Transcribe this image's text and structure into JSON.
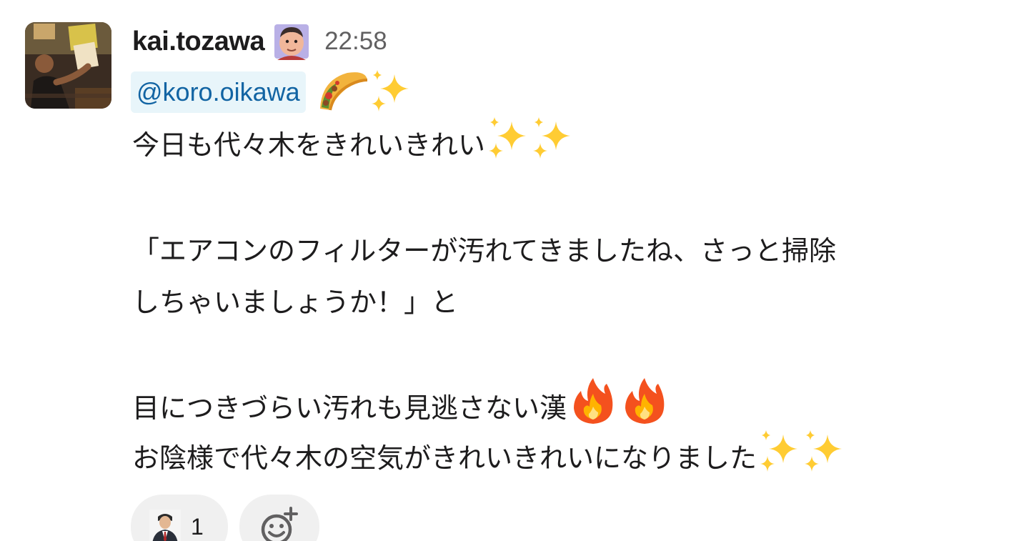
{
  "message": {
    "username": "kai.tozawa",
    "timestamp": "22:58",
    "mention": "@koro.oikawa",
    "lines": [
      "今日も代々木をきれいきれい",
      "",
      "「エアコンのフィルターが汚れてきましたね、さっと掃除",
      "しちゃいましょうか！」と",
      "",
      "目につきづらい汚れも見逃さない漢",
      "お陰様で代々木の空気がきれいきれいになりました"
    ],
    "icons": {
      "avatar": "user-photo-avatar",
      "status": "face-emoji",
      "mention_trailing": [
        "taco-emoji",
        "sparkles-emoji"
      ],
      "line1_trailing": [
        "sparkles-emoji",
        "sparkles-emoji"
      ],
      "line6_trailing": [
        "fire-emoji",
        "fire-emoji"
      ],
      "line7_trailing": [
        "sparkles-emoji",
        "sparkles-emoji"
      ]
    }
  },
  "reactions": [
    {
      "icon": "person-in-suit-avatar",
      "count": "1"
    }
  ],
  "add_reaction": {
    "icon": "add-emoji-reaction-icon"
  },
  "colors": {
    "mention_text": "#1264a3",
    "mention_bg": "#e8f5fa",
    "timestamp": "#616061",
    "reaction_bg": "#f0f0f0"
  }
}
